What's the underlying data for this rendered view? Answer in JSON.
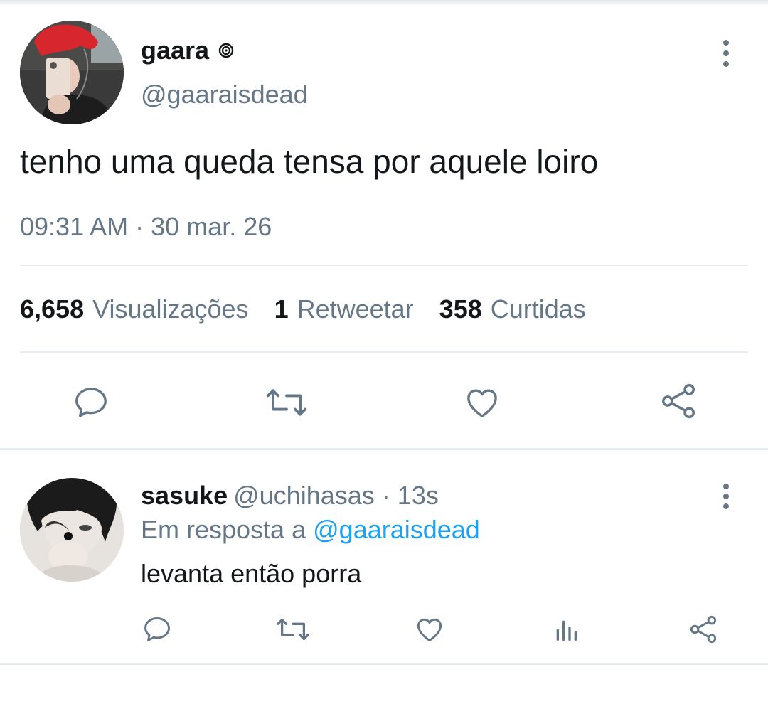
{
  "tweet": {
    "author_name": "gaara",
    "author_handle": "@gaaraisdead",
    "text": "tenho uma queda tensa por aquele loiro",
    "timestamp": "09:31 AM",
    "separator": "·",
    "date": "30 mar. 26",
    "stats": {
      "views_count": "6,658",
      "views_label": "Visualizações",
      "retweets_count": "1",
      "retweets_label": "Retweetar",
      "likes_count": "358",
      "likes_label": "Curtidas"
    },
    "actions": [
      "reply-icon",
      "retweet-icon",
      "like-icon",
      "share-icon"
    ]
  },
  "reply": {
    "author_name": "sasuke",
    "author_handle": "@uchihasas",
    "separator": "·",
    "time": "13s",
    "reply_to_label": "Em resposta a",
    "reply_to_handle": "@gaaraisdead",
    "text": "levanta então porra",
    "actions": [
      "reply-icon",
      "retweet-icon",
      "like-icon",
      "analytics-icon",
      "share-icon"
    ]
  },
  "colors": {
    "text": "#14171a",
    "muted": "#657786",
    "link": "#1da1f2",
    "divider": "#e6ecf0"
  }
}
